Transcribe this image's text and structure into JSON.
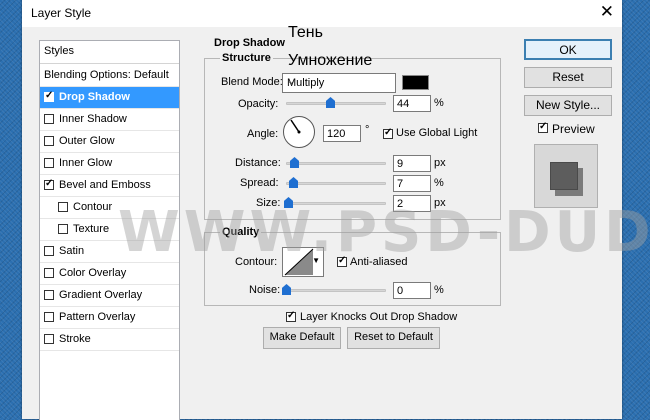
{
  "window": {
    "title": "Layer Style",
    "close_glyph": "✕"
  },
  "annotations": {
    "shadow_ru": "Тень",
    "multiply_ru": "Умножение"
  },
  "watermark": "WWW.PSD-DUDE.COM",
  "styles_panel": {
    "header": "Styles",
    "items": [
      {
        "label": "Blending Options: Default",
        "checkbox": false,
        "checked": false,
        "selected": false
      },
      {
        "label": "Drop Shadow",
        "checkbox": true,
        "checked": true,
        "selected": true
      },
      {
        "label": "Inner Shadow",
        "checkbox": true,
        "checked": false,
        "selected": false
      },
      {
        "label": "Outer Glow",
        "checkbox": true,
        "checked": false,
        "selected": false
      },
      {
        "label": "Inner Glow",
        "checkbox": true,
        "checked": false,
        "selected": false
      },
      {
        "label": "Bevel and Emboss",
        "checkbox": true,
        "checked": true,
        "selected": false
      },
      {
        "label": "Contour",
        "checkbox": true,
        "checked": false,
        "selected": false
      },
      {
        "label": "Texture",
        "checkbox": true,
        "checked": false,
        "selected": false
      },
      {
        "label": "Satin",
        "checkbox": true,
        "checked": false,
        "selected": false
      },
      {
        "label": "Color Overlay",
        "checkbox": true,
        "checked": false,
        "selected": false
      },
      {
        "label": "Gradient Overlay",
        "checkbox": true,
        "checked": false,
        "selected": false
      },
      {
        "label": "Pattern Overlay",
        "checkbox": true,
        "checked": false,
        "selected": false
      },
      {
        "label": "Stroke",
        "checkbox": true,
        "checked": false,
        "selected": false
      }
    ]
  },
  "drop_shadow": {
    "section_title": "Drop Shadow",
    "structure": {
      "title": "Structure",
      "blend_mode_label": "Blend Mode:",
      "blend_mode_value": "Multiply",
      "shadow_color": "#000000",
      "opacity_label": "Opacity:",
      "opacity_value": "44",
      "opacity_unit": "%",
      "opacity_fraction": 0.44,
      "angle_label": "Angle:",
      "angle_value": "120",
      "angle_unit": "°",
      "use_global_light_label": "Use Global Light",
      "use_global_light_checked": true,
      "distance_label": "Distance:",
      "distance_value": "9",
      "distance_unit": "px",
      "spread_label": "Spread:",
      "spread_value": "7",
      "spread_unit": "%",
      "size_label": "Size:",
      "size_value": "2",
      "size_unit": "px"
    },
    "quality": {
      "title": "Quality",
      "contour_label": "Contour:",
      "anti_aliased_label": "Anti-aliased",
      "anti_aliased_checked": true,
      "noise_label": "Noise:",
      "noise_value": "0",
      "noise_unit": "%"
    },
    "knockout_label": "Layer Knocks Out Drop Shadow",
    "knockout_checked": true,
    "make_default_label": "Make Default",
    "reset_default_label": "Reset to Default"
  },
  "right_panel": {
    "ok_label": "OK",
    "reset_label": "Reset",
    "new_style_label": "New Style...",
    "preview_label": "Preview",
    "preview_checked": true
  },
  "colors": {
    "accent_selected": "#3399ff",
    "slider_thumb": "#1f6fd1"
  }
}
